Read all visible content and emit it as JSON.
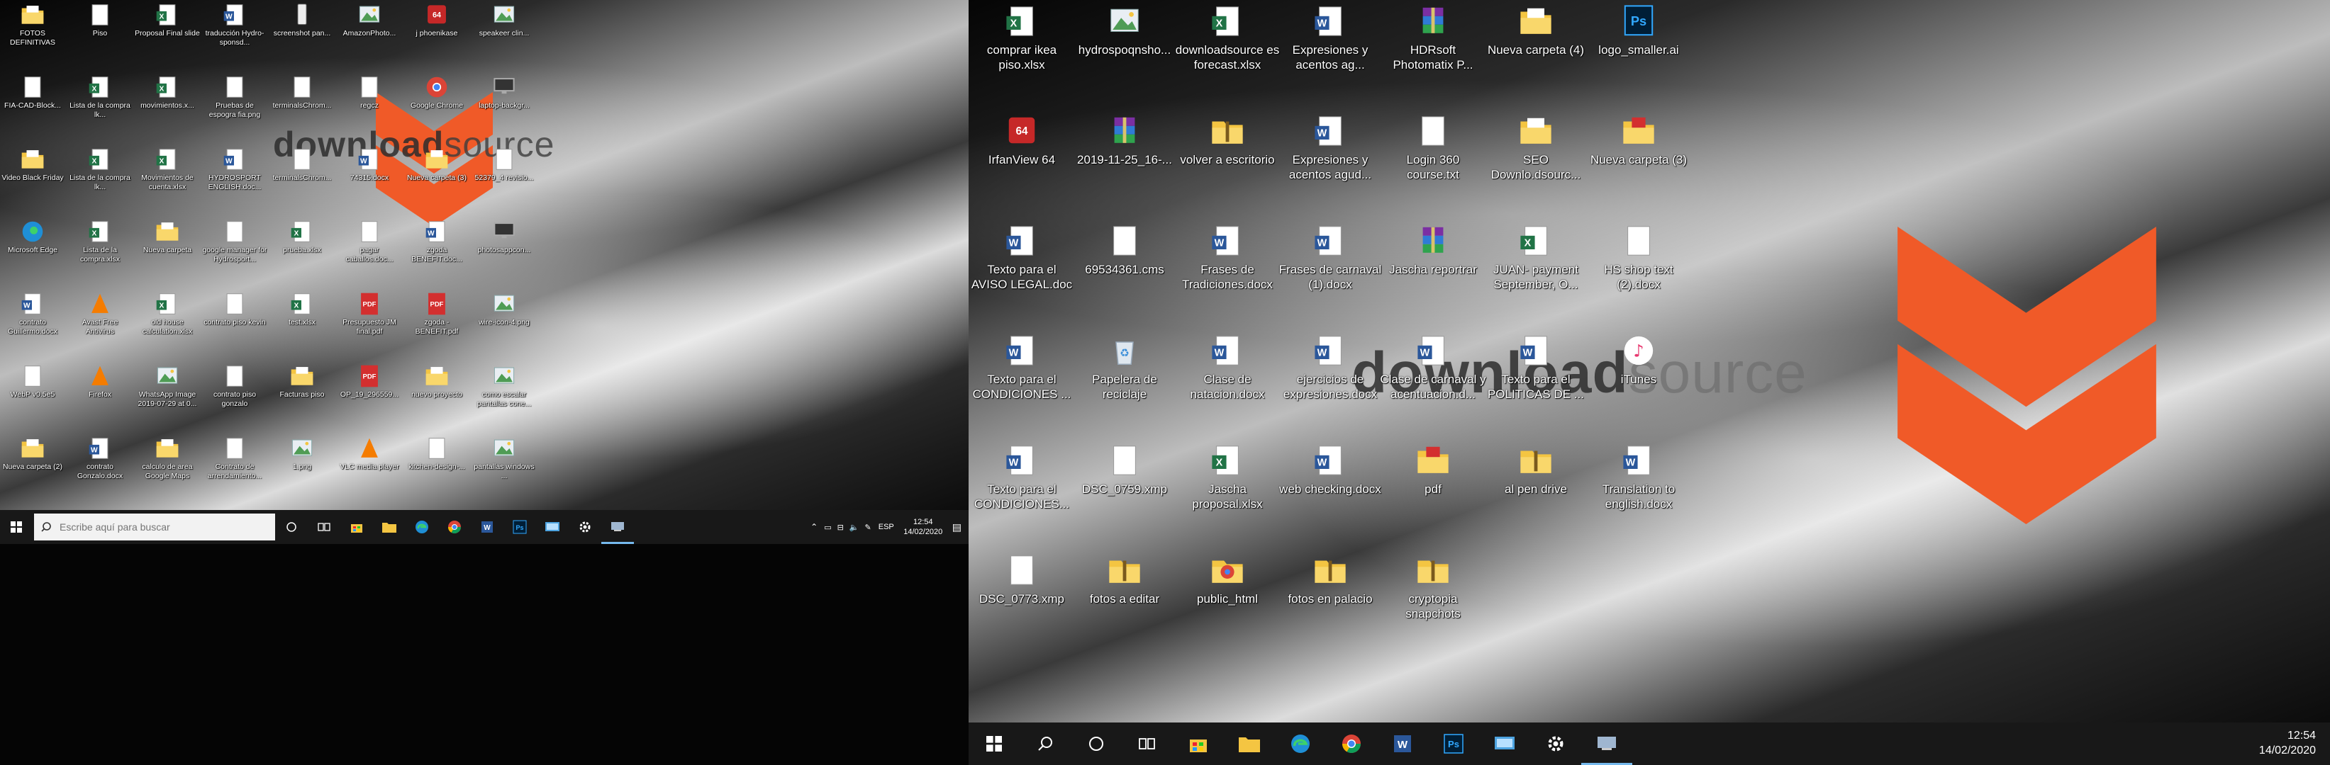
{
  "watermark": {
    "part1": "download",
    "part2": "source"
  },
  "left_monitor": {
    "icons": [
      {
        "label": "FOTOS DEFINITIVAS",
        "type": "folder"
      },
      {
        "label": "Piso",
        "type": "doc"
      },
      {
        "label": "Proposal Final slide",
        "type": "xlsx"
      },
      {
        "label": "traducción Hydro-sponsd...",
        "type": "word"
      },
      {
        "label": "screenshot pan...",
        "type": "phone"
      },
      {
        "label": "AmazonPhoto...",
        "type": "image"
      },
      {
        "label": "j phoenikase",
        "type": "app-red"
      },
      {
        "label": "speakeer clin...",
        "type": "image"
      },
      {
        "label": "FIA-CAD-Block...",
        "type": "doc"
      },
      {
        "label": "Lista de la compra lk...",
        "type": "xlsx"
      },
      {
        "label": "movimientos.x...",
        "type": "xlsx"
      },
      {
        "label": "Pruebas de espogra fia.png",
        "type": "doc"
      },
      {
        "label": "terminalsChrom...",
        "type": "doc"
      },
      {
        "label": "regcz",
        "type": "doc"
      },
      {
        "label": "Google Chrome",
        "type": "chrome"
      },
      {
        "label": "laptop-backgr...",
        "type": "monitor"
      },
      {
        "label": "Video Black Friday",
        "type": "folder"
      },
      {
        "label": "Lista de la compra lk...",
        "type": "xlsx"
      },
      {
        "label": "Movimientos de cuenta.xlsx",
        "type": "xlsx"
      },
      {
        "label": "HYDROSPORT ENGLISH.doc...",
        "type": "word"
      },
      {
        "label": "terminalsChrom...",
        "type": "doc"
      },
      {
        "label": "74315.docx",
        "type": "word"
      },
      {
        "label": "Nueva carpeta (3)",
        "type": "folder"
      },
      {
        "label": "52379_4 revisio...",
        "type": "doc"
      },
      {
        "label": "Microsoft Edge",
        "type": "edge"
      },
      {
        "label": "Lista de la compra.xlsx",
        "type": "xlsx"
      },
      {
        "label": "Nueva carpeta",
        "type": "folder"
      },
      {
        "label": "google manager for Hydrosport...",
        "type": "doc"
      },
      {
        "label": "prueba.xlsx",
        "type": "xlsx"
      },
      {
        "label": "pagar caballos.doc...",
        "type": "doc"
      },
      {
        "label": "zgoda BENEFIT.doc...",
        "type": "word"
      },
      {
        "label": "photosappcon...",
        "type": "monitor"
      },
      {
        "label": "contrato Guillermo.docx",
        "type": "word"
      },
      {
        "label": "Avast Free Antivirus",
        "type": "app-orange"
      },
      {
        "label": "old house calculation.xlsx",
        "type": "xlsx"
      },
      {
        "label": "contrato piso kevin",
        "type": "doc"
      },
      {
        "label": "test.xlsx",
        "type": "xlsx"
      },
      {
        "label": "Presupuesto JM final.pdf",
        "type": "pdf"
      },
      {
        "label": "zgoda - BENEFIT.pdf",
        "type": "pdf"
      },
      {
        "label": "wire-icon-4.png",
        "type": "image"
      },
      {
        "label": "WebP v0.5e5",
        "type": "doc"
      },
      {
        "label": "Firefox",
        "type": "app-orange"
      },
      {
        "label": "WhatsApp Image 2019-07-29 at 0...",
        "type": "image"
      },
      {
        "label": "contrato piso gonzalo",
        "type": "doc"
      },
      {
        "label": "Facturas piso",
        "type": "folder"
      },
      {
        "label": "OP_19_296559...",
        "type": "pdf"
      },
      {
        "label": "nuevo proyecto",
        "type": "folder"
      },
      {
        "label": "como escalar pantallas cone...",
        "type": "image"
      },
      {
        "label": "Nueva carpeta (2)",
        "type": "folder"
      },
      {
        "label": "contrato Gonzalo.docx",
        "type": "word"
      },
      {
        "label": "calculo de area Google Maps",
        "type": "folder"
      },
      {
        "label": "Contrato de arrendamiento...",
        "type": "doc"
      },
      {
        "label": "1.png",
        "type": "image"
      },
      {
        "label": "VLC media player",
        "type": "app-orange"
      },
      {
        "label": "kitchen-design-...",
        "type": "doc"
      },
      {
        "label": "pantallas windows ...",
        "type": "image"
      }
    ],
    "taskbar": {
      "search_placeholder": "Escribe aquí para buscar",
      "language": "ESP",
      "time": "12:54",
      "date": "14/02/2020"
    }
  },
  "right_monitor": {
    "icons": [
      {
        "label": "comprar ikea piso.xlsx",
        "type": "xlsx"
      },
      {
        "label": "hydrospoqnsho...",
        "type": "image"
      },
      {
        "label": "downloadsource es forecast.xlsx",
        "type": "xlsx"
      },
      {
        "label": "Expresiones y acentos ag...",
        "type": "word"
      },
      {
        "label": "HDRsoft Photomatix P...",
        "type": "winrar"
      },
      {
        "label": "Nueva carpeta (4)",
        "type": "folder"
      },
      {
        "label": "logo_smaller.ai",
        "type": "ps"
      },
      {
        "label": "IrfanView 64",
        "type": "app-red"
      },
      {
        "label": "2019-11-25_16-...",
        "type": "winrar"
      },
      {
        "label": "volver a escritorio",
        "type": "zip"
      },
      {
        "label": "Expresiones y acentos agud...",
        "type": "word"
      },
      {
        "label": "Login 360 course.txt",
        "type": "doc"
      },
      {
        "label": "SEO Downlo.dsourc...",
        "type": "folder"
      },
      {
        "label": "Nueva carpeta (3)",
        "type": "folder-red"
      },
      {
        "label": "Texto para el AVISO LEGAL.doc",
        "type": "word"
      },
      {
        "label": "69534361.cms",
        "type": "doc"
      },
      {
        "label": "Frases de Tradiciones.docx",
        "type": "word"
      },
      {
        "label": "Frases de carnaval (1).docx",
        "type": "word"
      },
      {
        "label": "Jascha reportrar",
        "type": "winrar"
      },
      {
        "label": "JUAN- payment September, O...",
        "type": "xlsx"
      },
      {
        "label": "HS shop text (2).docx",
        "type": "doc"
      },
      {
        "label": "Texto para el CONDICIONES ...",
        "type": "word"
      },
      {
        "label": "Papelera de reciclaje",
        "type": "recycle"
      },
      {
        "label": "Clase de natacion.docx",
        "type": "word"
      },
      {
        "label": "ejercicios de expresiones.docx",
        "type": "word"
      },
      {
        "label": "Clase de carnaval y acentuacion.d...",
        "type": "word"
      },
      {
        "label": "Texto para el POLITICAS DE ...",
        "type": "word"
      },
      {
        "label": "iTunes",
        "type": "itunes"
      },
      {
        "label": "Texto para el CONDICIONES...",
        "type": "word"
      },
      {
        "label": "DSC_0759.xmp",
        "type": "doc"
      },
      {
        "label": "Jascha proposal.xlsx",
        "type": "xlsx"
      },
      {
        "label": "web checking.docx",
        "type": "word"
      },
      {
        "label": "pdf",
        "type": "folder-red"
      },
      {
        "label": "al pen drive",
        "type": "zip"
      },
      {
        "label": "Translation to english.docx",
        "type": "word"
      },
      {
        "label": "DSC_0773.xmp",
        "type": "doc"
      },
      {
        "label": "fotos a editar",
        "type": "zip"
      },
      {
        "label": "public_html",
        "type": "chrome-folder"
      },
      {
        "label": "fotos en palacio",
        "type": "zip"
      },
      {
        "label": "cryptopia snapchots",
        "type": "zip"
      }
    ],
    "taskbar": {
      "time": "12:54",
      "date": "14/02/2020"
    }
  },
  "colors": {
    "accent": "#f05a28",
    "taskbar": "#181818",
    "word_blue": "#2b579a",
    "excel_green": "#217346",
    "folder": "#f4c542",
    "pdf_red": "#d32f2f"
  }
}
